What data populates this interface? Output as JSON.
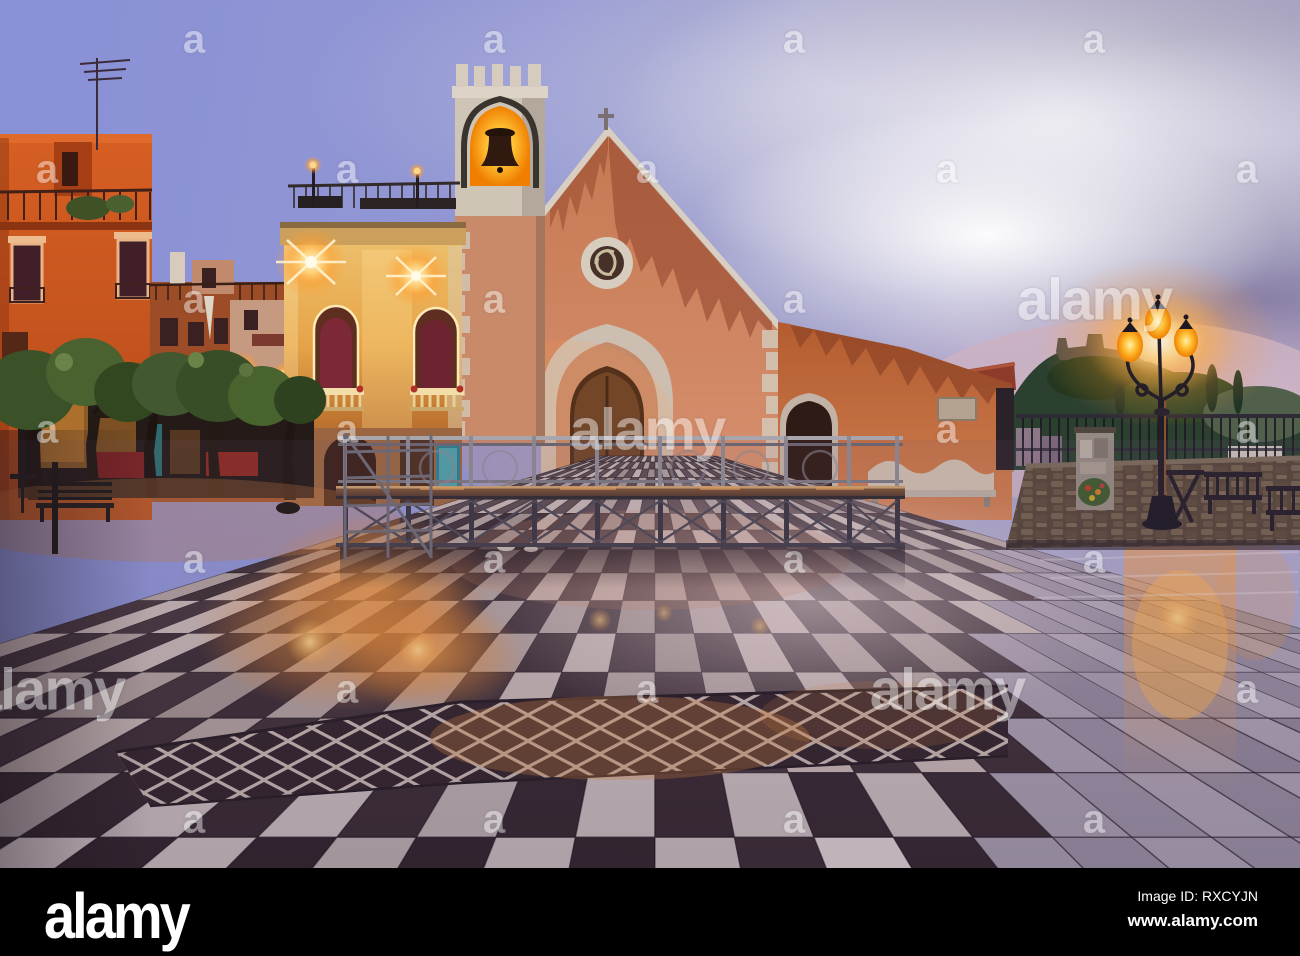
{
  "footer": {
    "brand": "alamy",
    "image_id": "Image ID: RXCYJN",
    "url": "www.alamy.com"
  },
  "watermark": {
    "brand": "alamy",
    "small_glyph": "a"
  },
  "colors": {
    "sky_left": "#8890d6",
    "sky_mid": "#a3a2cb",
    "sky_right": "#b0aacb",
    "cloud_bright": "#f4f2f5",
    "cloud_shadow": "#8e88a8",
    "horizon_pink": "#cbb2c2",
    "building_orange_lit": "#d65f22",
    "building_orange_shadow": "#b4491a",
    "palazzo_gold": "#e9a94f",
    "palazzo_cornice": "#caa05c",
    "church_plaster": "#cd8160",
    "church_stain": "#96482e",
    "stone_light": "#d6ccc0",
    "stone_shadow": "#b0a79c",
    "bell_glow_core": "#ffefb0",
    "bell_glow_deep": "#f07f00",
    "lamp_glow_core": "#fff6dc",
    "lamp_glow_halo": "#ff9e2e",
    "foliage_dark": "#32471f",
    "foliage_light": "#49622f",
    "pavement_light": "#b3a19e",
    "pavement_dark": "#2e222a",
    "pavement_right_tile": "#a59bb4",
    "reflection_warm": "#e08a3c",
    "stage_metal": "#8d8a94",
    "stage_deck": "#7a5236",
    "wall_stone": "#5f4f41",
    "watermark_white": "#ffffff",
    "footer_bg": "#000000",
    "footer_text": "#ffffff"
  }
}
